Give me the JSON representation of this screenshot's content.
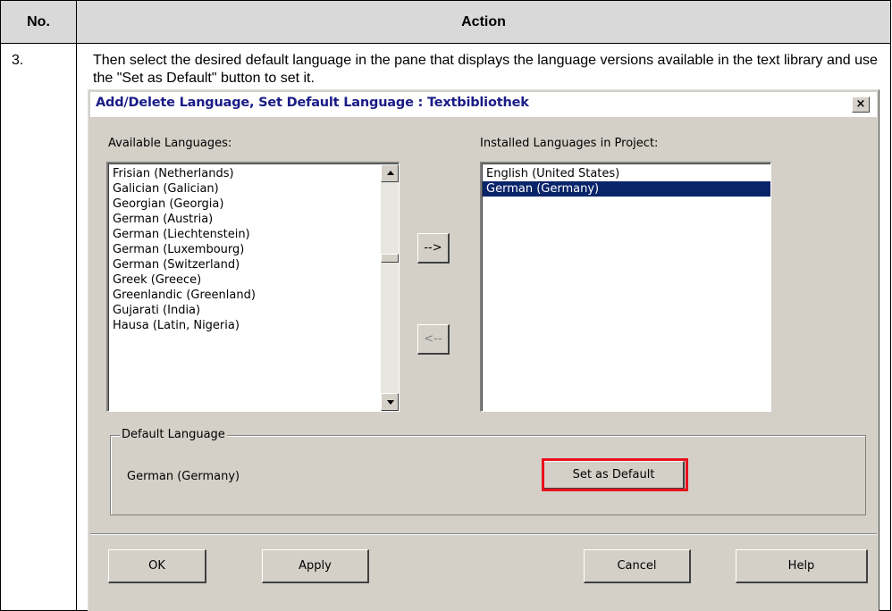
{
  "table": {
    "headers": {
      "no": "No.",
      "action": "Action"
    },
    "step": "3.",
    "instruction": "Then select the desired default language in the pane that displays the language versions available in the text library and use the \"Set as Default\" button to set it."
  },
  "dialog": {
    "title": "Add/Delete Language, Set Default Language : Textbibliothek",
    "close_glyph": "×",
    "available_label": "Available Languages:",
    "installed_label": "Installed Languages in Project:",
    "available_languages": [
      "Frisian (Netherlands)",
      "Galician (Galician)",
      "Georgian (Georgia)",
      "German (Austria)",
      "German (Liechtenstein)",
      "German (Luxembourg)",
      "German (Switzerland)",
      "Greek (Greece)",
      "Greenlandic (Greenland)",
      "Gujarati (India)",
      "Hausa (Latin, Nigeria)"
    ],
    "installed_languages": [
      "English (United States)",
      "German (Germany)"
    ],
    "selected_installed": "German (Germany)",
    "add_label": "-->",
    "remove_label": "<--",
    "default_group_label": "Default Language",
    "default_value": "German (Germany)",
    "set_default_label": "Set as Default",
    "buttons": {
      "ok": "OK",
      "apply": "Apply",
      "cancel": "Cancel",
      "help": "Help"
    },
    "colors": {
      "highlight": "#e8101c",
      "selection": "#0a246a",
      "title": "#1a1c86"
    }
  }
}
